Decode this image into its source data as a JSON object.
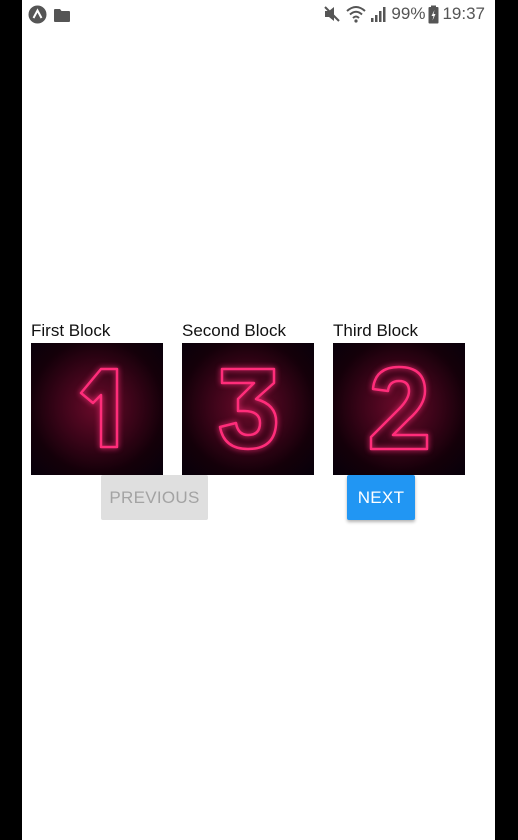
{
  "status_bar": {
    "left_icons": [
      "app-logo-icon",
      "folder-icon"
    ],
    "right_icons": [
      "mute-icon",
      "wifi-icon",
      "signal-icon",
      "battery-icon"
    ],
    "battery": "99%",
    "time": "19:37"
  },
  "blocks": [
    {
      "label": "First Block",
      "numeral": "1"
    },
    {
      "label": "Second Block",
      "numeral": "3"
    },
    {
      "label": "Third Block",
      "numeral": "2"
    }
  ],
  "buttons": {
    "previous_label": "PREVIOUS",
    "next_label": "NEXT"
  },
  "colors": {
    "neon": "#ff2d7a",
    "next_button": "#2196f3",
    "previous_button": "#dfdfdf"
  }
}
